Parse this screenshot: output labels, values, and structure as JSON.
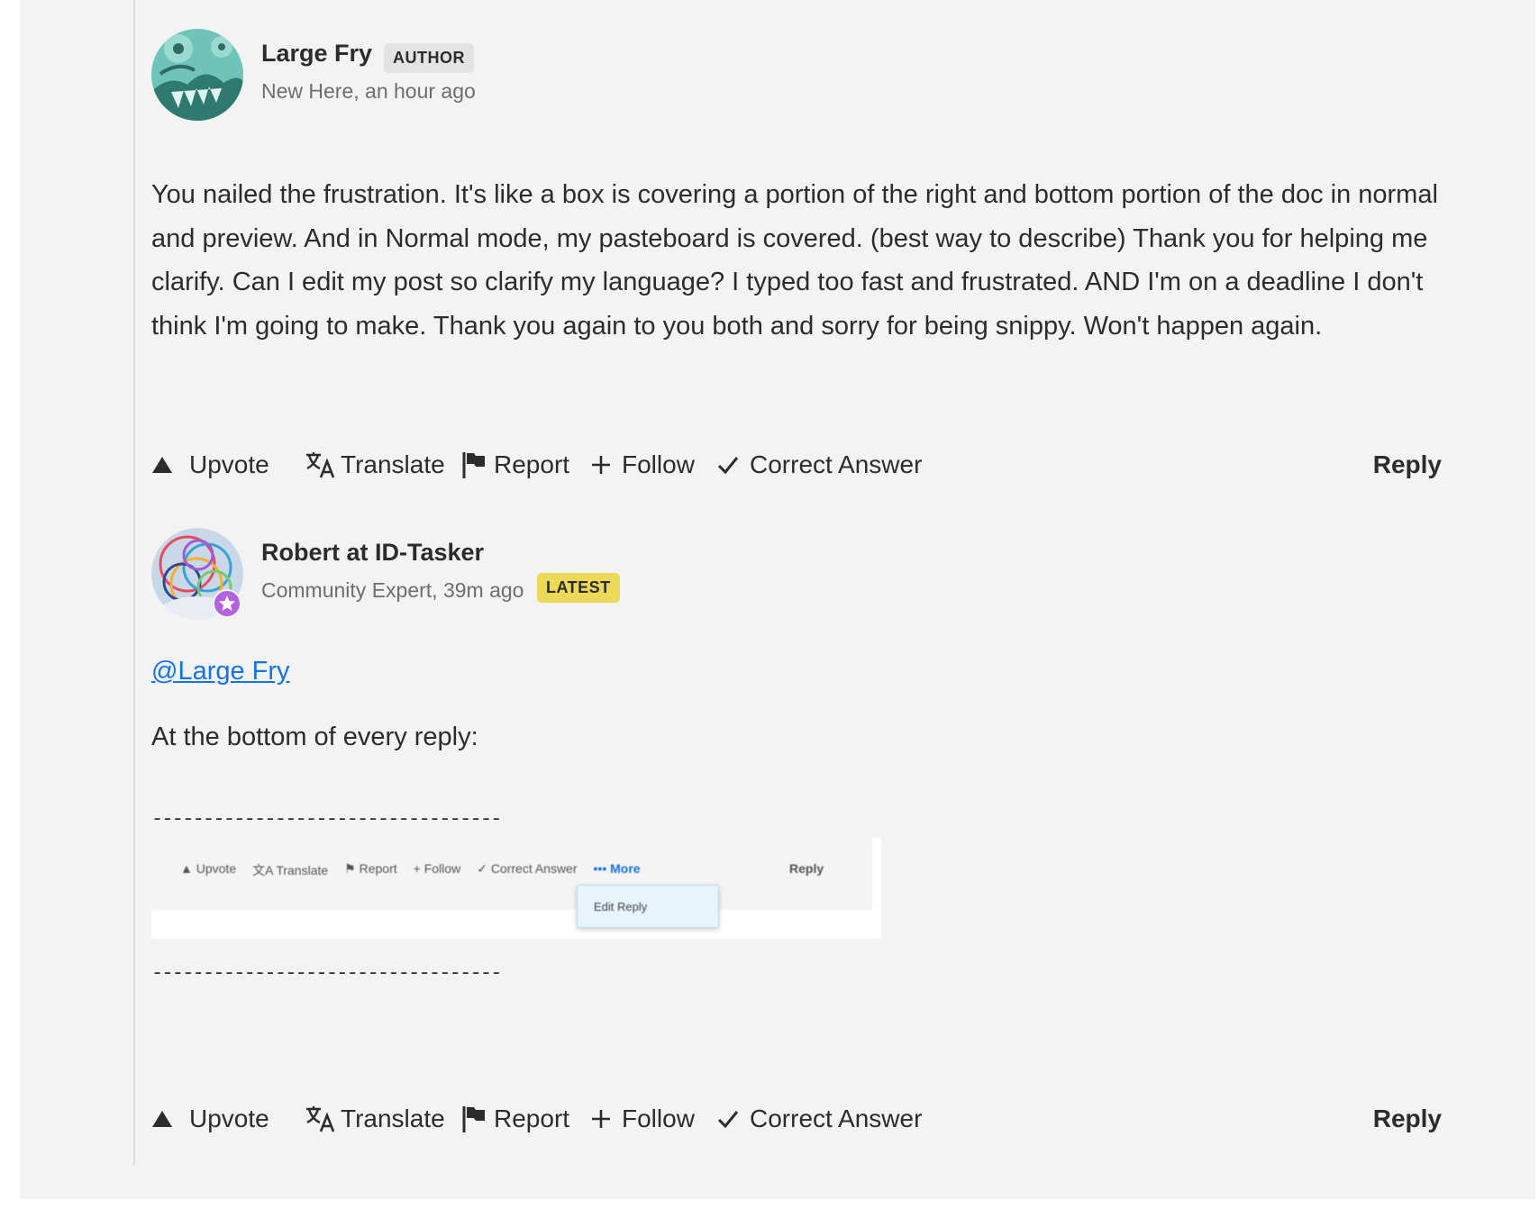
{
  "replies": [
    {
      "author": "Large Fry",
      "badge": "AUTHOR",
      "meta": "New Here, an hour ago",
      "avatar_icon": "monster-avatar",
      "body": "You nailed the frustration. It's like a box is covering a portion of the right and bottom portion of the doc in normal and preview. And in Normal mode, my pasteboard is covered. (best way to describe) Thank you for helping me clarify. Can I edit my post so clarify my language? I typed too fast and frustrated. AND I'm on a deadline I don't think I'm going to make. Thank you again to you both and sorry for being snippy. Won't happen again."
    },
    {
      "author": "Robert at ID-Tasker",
      "badge": "LATEST",
      "meta": "Community Expert, 39m ago",
      "avatar_icon": "abstract-avatar",
      "mention": "@Large Fry",
      "paragraph": "At the bottom of every reply:",
      "divider": "----------------------------------",
      "embedded_screenshot": {
        "actions": [
          "Upvote",
          "Translate",
          "Report",
          "Follow",
          "Correct Answer"
        ],
        "more": "••• More",
        "reply": "Reply",
        "menu_item": "Edit Reply"
      }
    }
  ],
  "actions": {
    "upvote": "Upvote",
    "translate": "Translate",
    "report": "Report",
    "follow": "Follow",
    "correct_answer": "Correct Answer",
    "reply": "Reply"
  },
  "colors": {
    "panel_bg": "#f3f3f3",
    "link": "#1473e6",
    "badge_latest": "#ecd95a",
    "badge_author": "#e3e3e3",
    "avatar_teal": "#6fc3b8",
    "expert_star": "#b461e3"
  }
}
